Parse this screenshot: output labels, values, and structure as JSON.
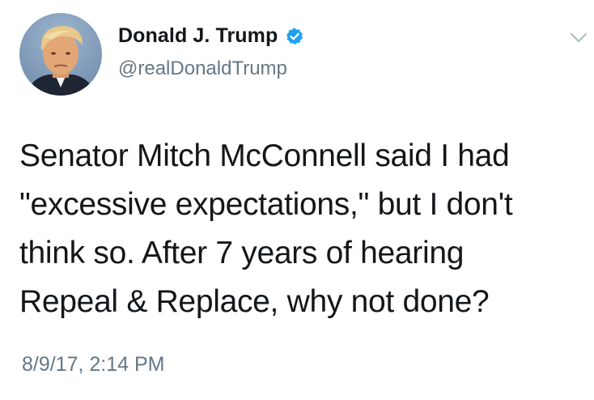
{
  "author": {
    "display_name": "Donald J. Trump",
    "handle": "@realDonaldTrump",
    "verified_icon": "verified-badge-icon",
    "verified_color": "#1da1f2"
  },
  "menu": {
    "icon": "chevron-down-icon"
  },
  "tweet": {
    "lines": [
      "Senator Mitch McConnell said I had",
      "\"excessive expectations,\" but I don't",
      "think so. After 7 years of hearing",
      "Repeal & Replace, why not done?"
    ],
    "timestamp": "8/9/17, 2:14 PM"
  },
  "colors": {
    "text_primary": "#14171a",
    "text_secondary": "#657786",
    "caret": "#aab8c2"
  }
}
